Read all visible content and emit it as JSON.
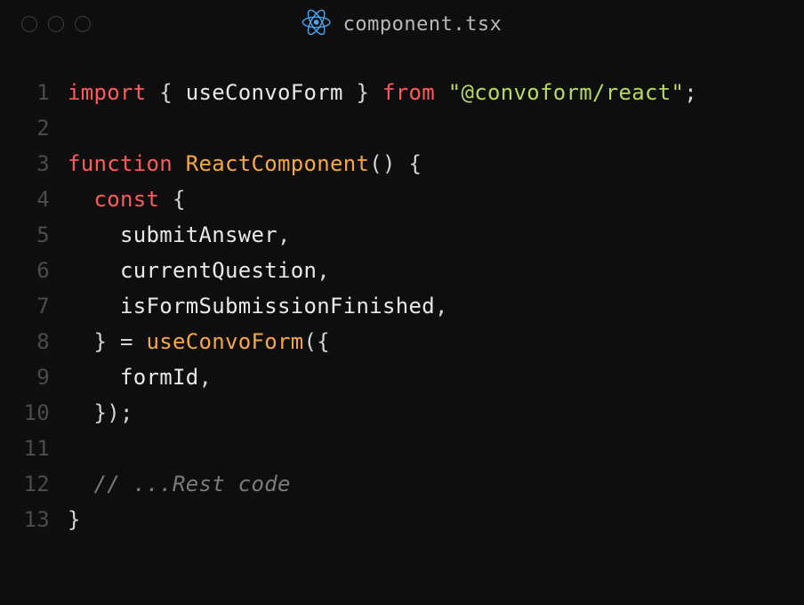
{
  "titlebar": {
    "filename": "component.tsx"
  },
  "code": {
    "l1": {
      "num": "1",
      "kw_import": "import",
      "brace_open": " { ",
      "hook": "useConvoForm",
      "brace_close": " } ",
      "kw_from": "from",
      "sp": " ",
      "str": "\"@convoform/react\"",
      "semi": ";"
    },
    "l2": {
      "num": "2"
    },
    "l3": {
      "num": "3",
      "kw_function": "function",
      "sp": " ",
      "name": "ReactComponent",
      "parens": "()",
      "brace": " {"
    },
    "l4": {
      "num": "4",
      "indent": "  ",
      "kw_const": "const",
      "brace": " {"
    },
    "l5": {
      "num": "5",
      "indent": "    ",
      "ident": "submitAnswer",
      "comma": ","
    },
    "l6": {
      "num": "6",
      "indent": "    ",
      "ident": "currentQuestion",
      "comma": ","
    },
    "l7": {
      "num": "7",
      "indent": "    ",
      "ident": "isFormSubmissionFinished",
      "comma": ","
    },
    "l8": {
      "num": "8",
      "indent": "  ",
      "brace_close": "} = ",
      "hook": "useConvoForm",
      "paren_brace": "({"
    },
    "l9": {
      "num": "9",
      "indent": "    ",
      "ident": "formId",
      "comma": ","
    },
    "l10": {
      "num": "10",
      "indent": "  ",
      "close": "});"
    },
    "l11": {
      "num": "11"
    },
    "l12": {
      "num": "12",
      "indent": "  ",
      "comment": "// ...Rest code"
    },
    "l13": {
      "num": "13",
      "close": "}"
    }
  }
}
